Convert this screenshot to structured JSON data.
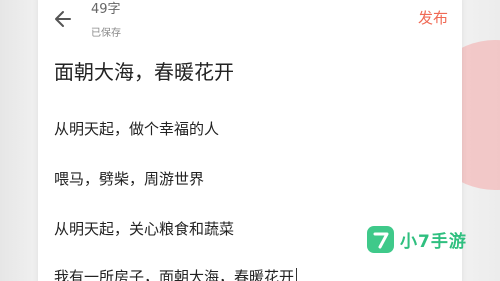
{
  "header": {
    "word_count": "49字",
    "save_status": "已保存",
    "publish_label": "发布"
  },
  "editor": {
    "title": "面朝大海，春暖花开",
    "lines": [
      "从明天起，做个幸福的人",
      "喂马，劈柴，周游世界",
      "从明天起，关心粮食和蔬菜",
      "我有一所房子，面朝大海，春暖花开"
    ]
  },
  "watermark": {
    "text": "小7手游",
    "color": "#3fc98a"
  },
  "colors": {
    "accent": "#f06a55"
  },
  "icons": {
    "back": "arrow-left-icon",
    "logo": "seven-logo-icon"
  }
}
